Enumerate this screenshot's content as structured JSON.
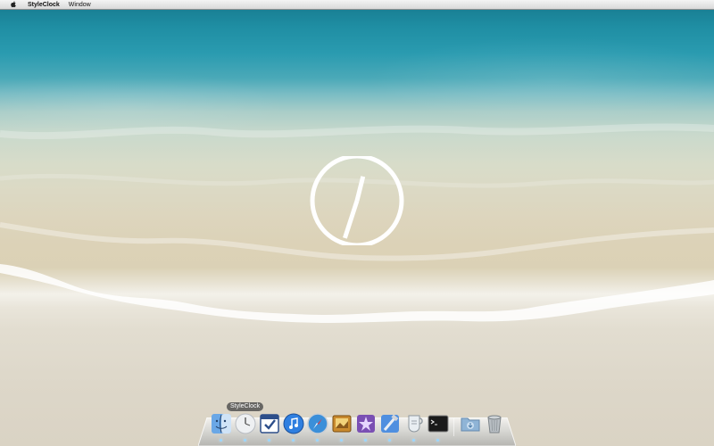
{
  "menubar": {
    "app_name": "StyleClock",
    "menus": [
      "Window"
    ]
  },
  "clock": {
    "hour_hand_deg": 14,
    "minute_hand_deg": 198,
    "color": "#ffffff"
  },
  "dock": {
    "tooltip": "StyleClock",
    "icons": [
      {
        "name": "finder-icon",
        "running": true
      },
      {
        "name": "styleclock-icon",
        "running": true
      },
      {
        "name": "omnifocus-icon",
        "running": true
      },
      {
        "name": "itunes-icon",
        "running": true
      },
      {
        "name": "safari-icon",
        "running": true
      },
      {
        "name": "iphoto-icon",
        "running": true
      },
      {
        "name": "photo-app-icon",
        "running": true
      },
      {
        "name": "xcode-icon",
        "running": true
      },
      {
        "name": "script-editor-icon",
        "running": true
      },
      {
        "name": "terminal-icon",
        "running": true
      },
      {
        "name": "downloads-stack-icon",
        "running": false
      },
      {
        "name": "trash-icon",
        "running": false
      }
    ]
  },
  "colors": {
    "water_deep": "#16788d",
    "sand": "#dcd2b7",
    "dock_indicator": "#9ad7ff"
  }
}
